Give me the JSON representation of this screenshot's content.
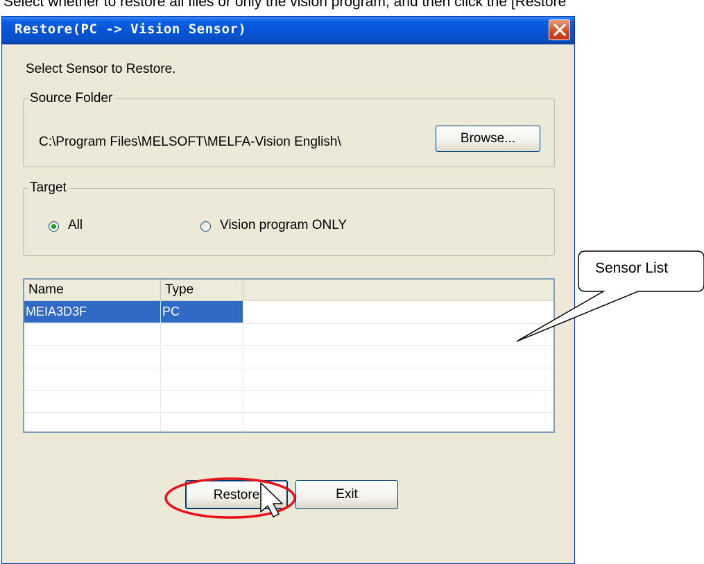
{
  "instruction": "Select whether to restore all files or only the vision program, and then click the [Restore",
  "window": {
    "title": "Restore(PC -> Vision Sensor)"
  },
  "prompt": "Select Sensor to Restore.",
  "source_folder": {
    "label": "Source Folder",
    "path": "C:\\Program Files\\MELSOFT\\MELFA-Vision English\\",
    "browse_label": "Browse..."
  },
  "target": {
    "label": "Target",
    "options": [
      {
        "label": "All",
        "selected": true
      },
      {
        "label": "Vision program ONLY",
        "selected": false
      }
    ]
  },
  "sensor_list": {
    "columns": [
      "Name",
      "Type"
    ],
    "rows": [
      {
        "name": "MEIA3D3F",
        "type": "PC",
        "selected": true
      }
    ]
  },
  "buttons": {
    "restore_label": "Restore",
    "exit_label": "Exit"
  },
  "callout": {
    "text": "Sensor List"
  },
  "colors": {
    "title_bar": "#0553d4",
    "selection": "#316ac5",
    "highlight_ellipse": "#e8121a",
    "dialog_bg": "#ece9d8"
  }
}
